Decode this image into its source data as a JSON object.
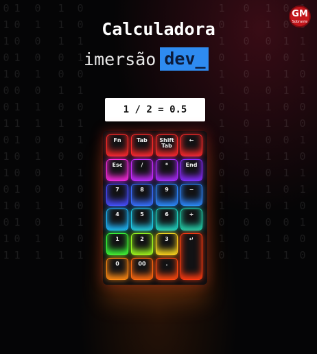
{
  "header": {
    "title": "Calculadora",
    "subtitle_prefix": "imersão",
    "subtitle_tag": "dev_"
  },
  "logo": {
    "mark": "GM",
    "sub": "Sobrante"
  },
  "display": {
    "expression": "1 / 2 = 0.5"
  },
  "keys": [
    {
      "label": "Fn",
      "glow": "#ff2a2a"
    },
    {
      "label": "Tab",
      "glow": "#ff2a2a"
    },
    {
      "label": "Shift Tab",
      "glow": "#ff2a2a"
    },
    {
      "label": "←",
      "glow": "#ff2a2a"
    },
    {
      "label": "Esc",
      "glow": "#ff2ae0"
    },
    {
      "label": "/",
      "glow": "#c82aff"
    },
    {
      "label": "*",
      "glow": "#b02aff"
    },
    {
      "label": "End",
      "glow": "#8a2aff"
    },
    {
      "label": "7",
      "glow": "#4a4aff"
    },
    {
      "label": "8",
      "glow": "#3a6cff"
    },
    {
      "label": "9",
      "glow": "#2e86ff"
    },
    {
      "label": "−",
      "glow": "#2e86ff"
    },
    {
      "label": "4",
      "glow": "#20b8ff"
    },
    {
      "label": "5",
      "glow": "#20c8e8"
    },
    {
      "label": "6",
      "glow": "#20d8c8"
    },
    {
      "label": "+",
      "glow": "#22d6b0"
    },
    {
      "label": "1",
      "glow": "#3aff3a"
    },
    {
      "label": "2",
      "glow": "#9cff20"
    },
    {
      "label": "3",
      "glow": "#ffe020"
    },
    {
      "label": "0",
      "glow": "#ff8a14"
    },
    {
      "label": "00",
      "glow": "#ff6a10"
    },
    {
      "label": ".",
      "glow": "#ff4a10"
    },
    {
      "label": "↵",
      "glow": "#ff3a10"
    }
  ],
  "matrix": {
    "columns": [
      "1001001110010101",
      "0100101101001011",
      "1110010100101101",
      "0011010110100101",
      "1010110100011010",
      "0101001011011001",
      "1100101101010011",
      "0010110101101001",
      "1011010010110100",
      "0110100101101011"
    ]
  }
}
